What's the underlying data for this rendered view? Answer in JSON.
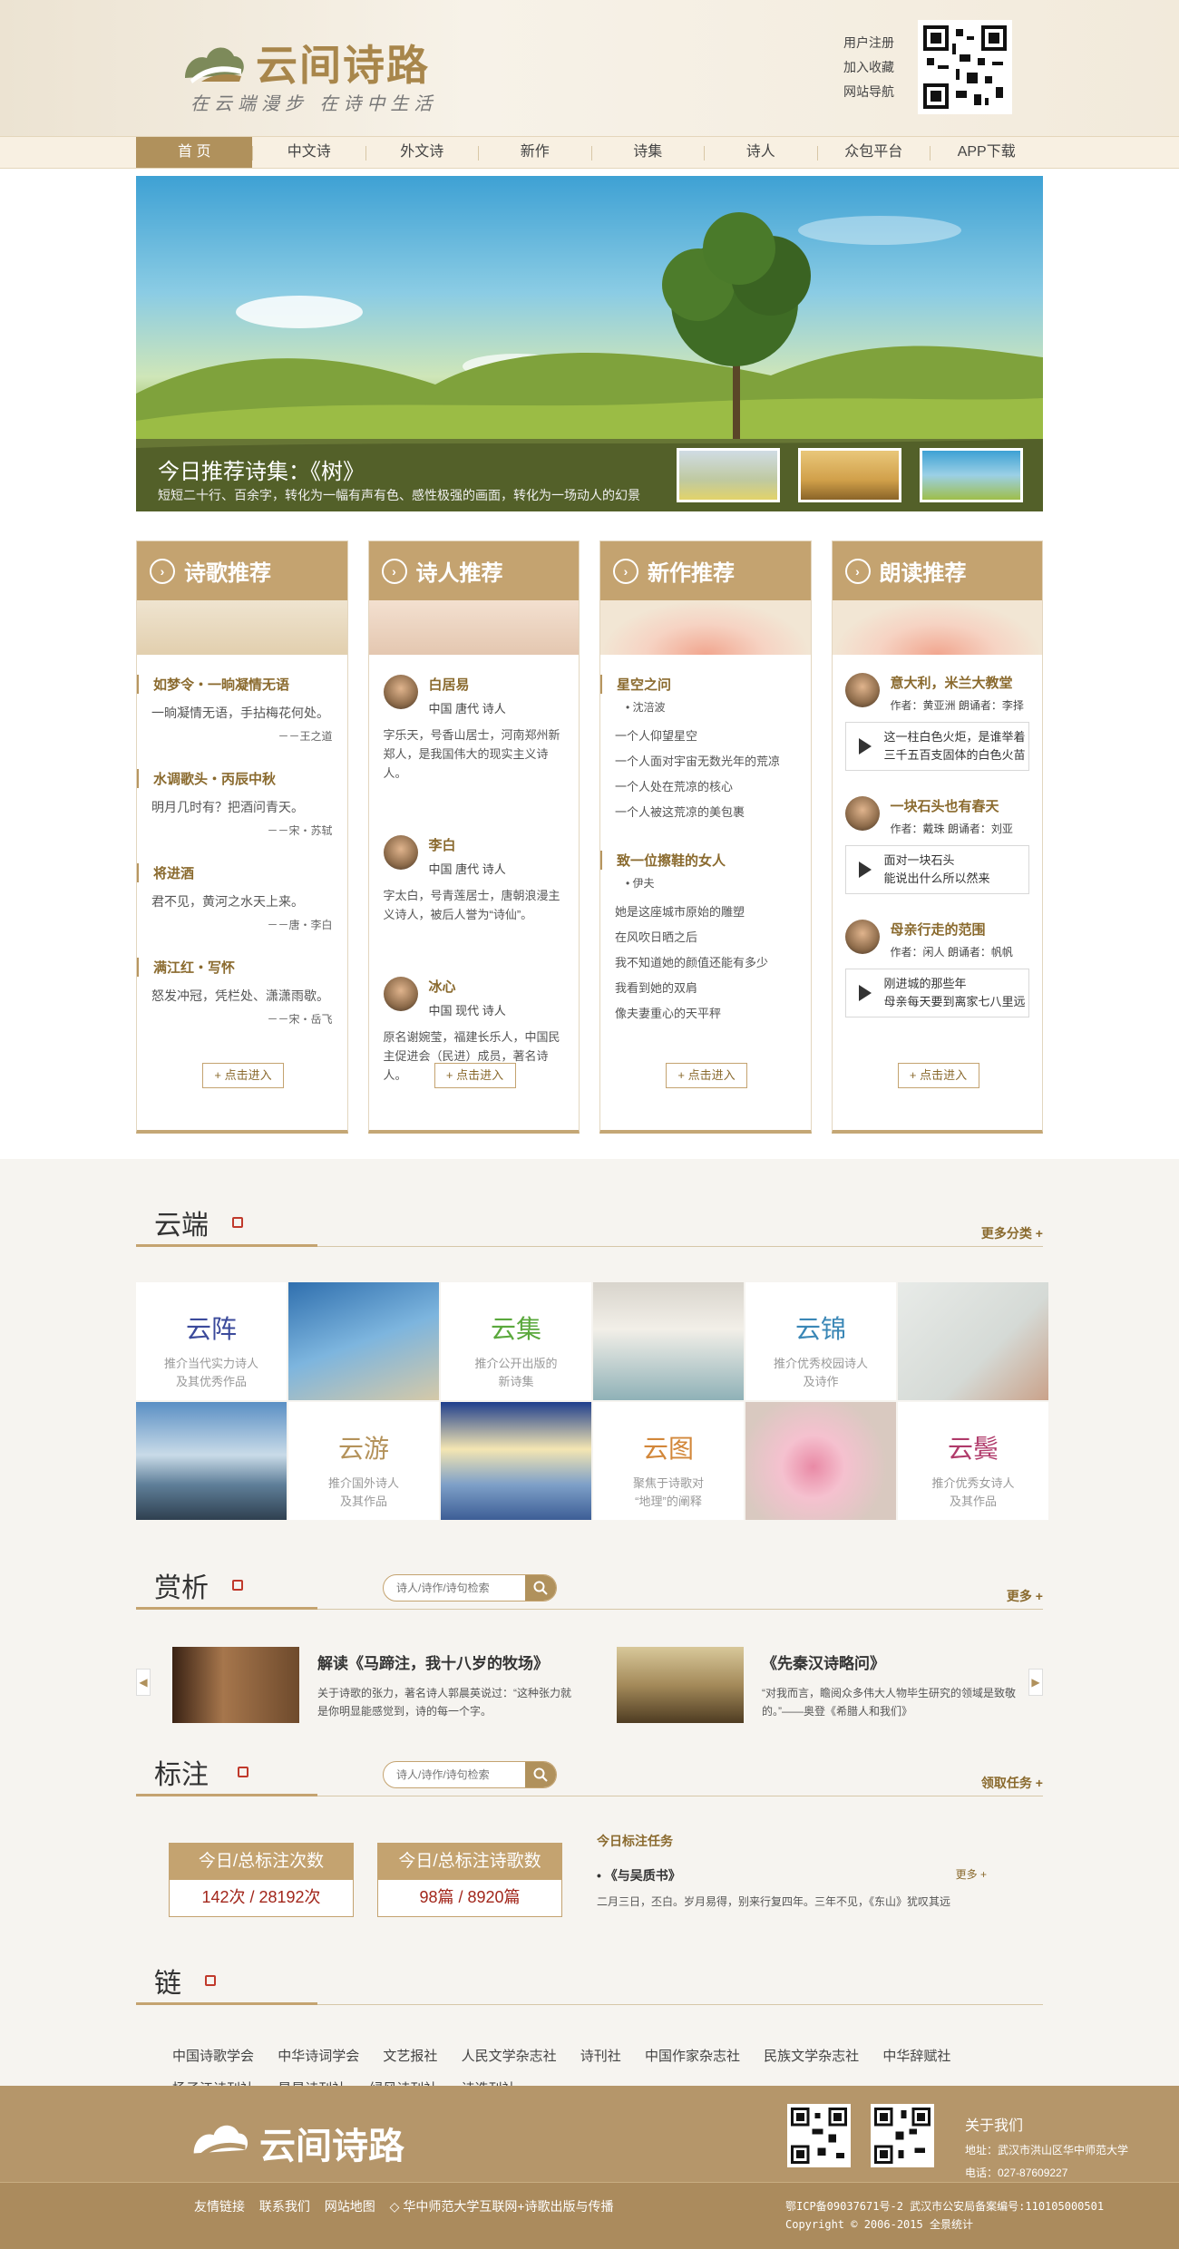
{
  "header": {
    "logo_text": "云间诗路",
    "slogan": "在云端漫步   在诗中生活",
    "links": [
      "用户注册",
      "加入收藏",
      "网站导航"
    ]
  },
  "nav": [
    "首 页",
    "中文诗",
    "外文诗",
    "新作",
    "诗集",
    "诗人",
    "众包平台",
    "APP下载"
  ],
  "banner": {
    "title": "今日推荐诗集：《树》",
    "desc": "短短二十行、百余字，转化为一幅有声有色、感性极强的画面，转化为一场动人的幻景"
  },
  "cards": {
    "poems": {
      "title": "诗歌推荐",
      "items": [
        {
          "t": "如梦令・一晌凝情无语",
          "l": "一晌凝情无语，手拈梅花何处。",
          "a": "－－王之道"
        },
        {
          "t": "水调歌头・丙辰中秋",
          "l": "明月几时有？把酒问青天。",
          "a": "－－宋・苏轼"
        },
        {
          "t": "将进酒",
          "l": "君不见，黄河之水天上来。",
          "a": "－－唐・李白"
        },
        {
          "t": "满江红・写怀",
          "l": "怒发冲冠，凭栏处、潇潇雨歇。",
          "a": "－－宋・岳飞"
        }
      ],
      "more": "+ 点击进入"
    },
    "poets": {
      "title": "诗人推荐",
      "items": [
        {
          "n": "白居易",
          "m": "中国  唐代  诗人",
          "d": "字乐天，号香山居士，河南郑州新郑人，是我国伟大的现实主义诗人。"
        },
        {
          "n": "李白",
          "m": "中国  唐代  诗人",
          "d": "字太白，号青莲居士，唐朝浪漫主义诗人，被后人誉为“诗仙”。"
        },
        {
          "n": "冰心",
          "m": "中国  现代  诗人",
          "d": "原名谢婉莹，福建长乐人，中国民主促进会（民进）成员，著名诗人。"
        }
      ],
      "more": "+ 点击进入"
    },
    "new": {
      "title": "新作推荐",
      "items": [
        {
          "t": "星空之问",
          "a": "沈涪波",
          "lines": [
            "一个人仰望星空",
            "一个人面对宇宙无数光年的荒凉",
            "一个人处在荒凉的核心",
            "一个人被这荒凉的美包裹"
          ]
        },
        {
          "t": "致一位擦鞋的女人",
          "a": "伊夫",
          "lines": [
            "她是这座城市原始的雕塑",
            "在风吹日晒之后",
            "我不知道她的颜值还能有多少",
            "我看到她的双肩",
            "像夫妻重心的天平秤"
          ]
        }
      ],
      "more": "+ 点击进入"
    },
    "reading": {
      "title": "朗读推荐",
      "items": [
        {
          "n": "意大利，米兰大教堂",
          "m": "作者：黄亚洲  朗诵者：李择",
          "l1": "这一柱白色火炬，是谁举着",
          "l2": "三千五百支固体的白色火苗"
        },
        {
          "n": "一块石头也有春天",
          "m": "作者：戴珠  朗诵者：刘亚",
          "l1": "面对一块石头",
          "l2": "能说出什么所以然来"
        },
        {
          "n": "母亲行走的范围",
          "m": "作者：闲人  朗诵者：帆帆",
          "l1": "刚进城的那些年",
          "l2": "母亲每天要到离家七八里远"
        }
      ],
      "more": "+ 点击进入"
    }
  },
  "cloud": {
    "title": "云端",
    "more": "更多分类  +",
    "cells": [
      {
        "t": "云阵",
        "d1": "推介当代实力诗人",
        "d2": "及其优秀作品",
        "color": "#3b4a9b"
      },
      {
        "t": "云集",
        "d1": "推介公开出版的",
        "d2": "新诗集",
        "color": "#5aa83c"
      },
      {
        "t": "云锦",
        "d1": "推介优秀校园诗人",
        "d2": "及诗作",
        "color": "#3a87b6"
      },
      {
        "t": "云游",
        "d1": "推介国外诗人",
        "d2": "及其作品",
        "color": "#b4925a"
      },
      {
        "t": "云图",
        "d1": "聚焦于诗歌对",
        "d2": "“地理”的阐释",
        "color": "#d2873a"
      },
      {
        "t": "云鬓",
        "d1": "推介优秀女诗人",
        "d2": "及其作品",
        "color": "#b03a6a"
      }
    ]
  },
  "appreciation": {
    "title": "赏析",
    "search_placeholder": "诗人/诗作/诗句检索",
    "more": "更多  +",
    "items": [
      {
        "t": "解读《马蹄注，我十八岁的牧场》",
        "d": "关于诗歌的张力，著名诗人郭晨英说过：“这种张力就是你明显能感觉到，诗的每一个字。"
      },
      {
        "t": "《先秦汉诗略问》",
        "d": "“对我而言，瞻阅众多伟大人物毕生研究的领域是致敬的。”——奥登《希腊人和我们》"
      }
    ]
  },
  "annotate": {
    "title": "标注",
    "search_placeholder": "诗人/诗作/诗句检索",
    "more": "领取任务  +",
    "stats": [
      {
        "h": "今日/总标注次数",
        "v": "142次  / 28192次"
      },
      {
        "h": "今日/总标注诗歌数",
        "v": "98篇  / 8920篇"
      }
    ],
    "task": {
      "h": "今日标注任务",
      "t": "《与吴质书》",
      "more": "更多  +",
      "c": "二月三日，丕白。岁月易得，别来行复四年。三年不见，《东山》犹叹其远"
    }
  },
  "links_section": {
    "title": "链",
    "row1": [
      "中国诗歌学会",
      "中华诗词学会",
      "文艺报社",
      "人民文学杂志社",
      "诗刊社",
      "中国作家杂志社",
      "民族文学杂志社",
      "中华辞赋社"
    ],
    "row2": [
      "扬子江诗刊社",
      "星星诗刊社",
      "绿风诗刊社",
      "诗选刊社"
    ]
  },
  "footer": {
    "logo_text": "云间诗路",
    "about_title": "关于我们",
    "address": "地址：武汉市洪山区华中师范大学",
    "phone": "电话：027-87609227",
    "links": [
      "友情链接",
      "联系我们",
      "网站地图",
      "◇  华中师范大学互联网+诗歌出版与传播"
    ],
    "icp": "鄂ICP备09037671号-2   武汉市公安局备案编号:110105000501",
    "copyright": "Copyright © 2006-2015 全景统计"
  }
}
